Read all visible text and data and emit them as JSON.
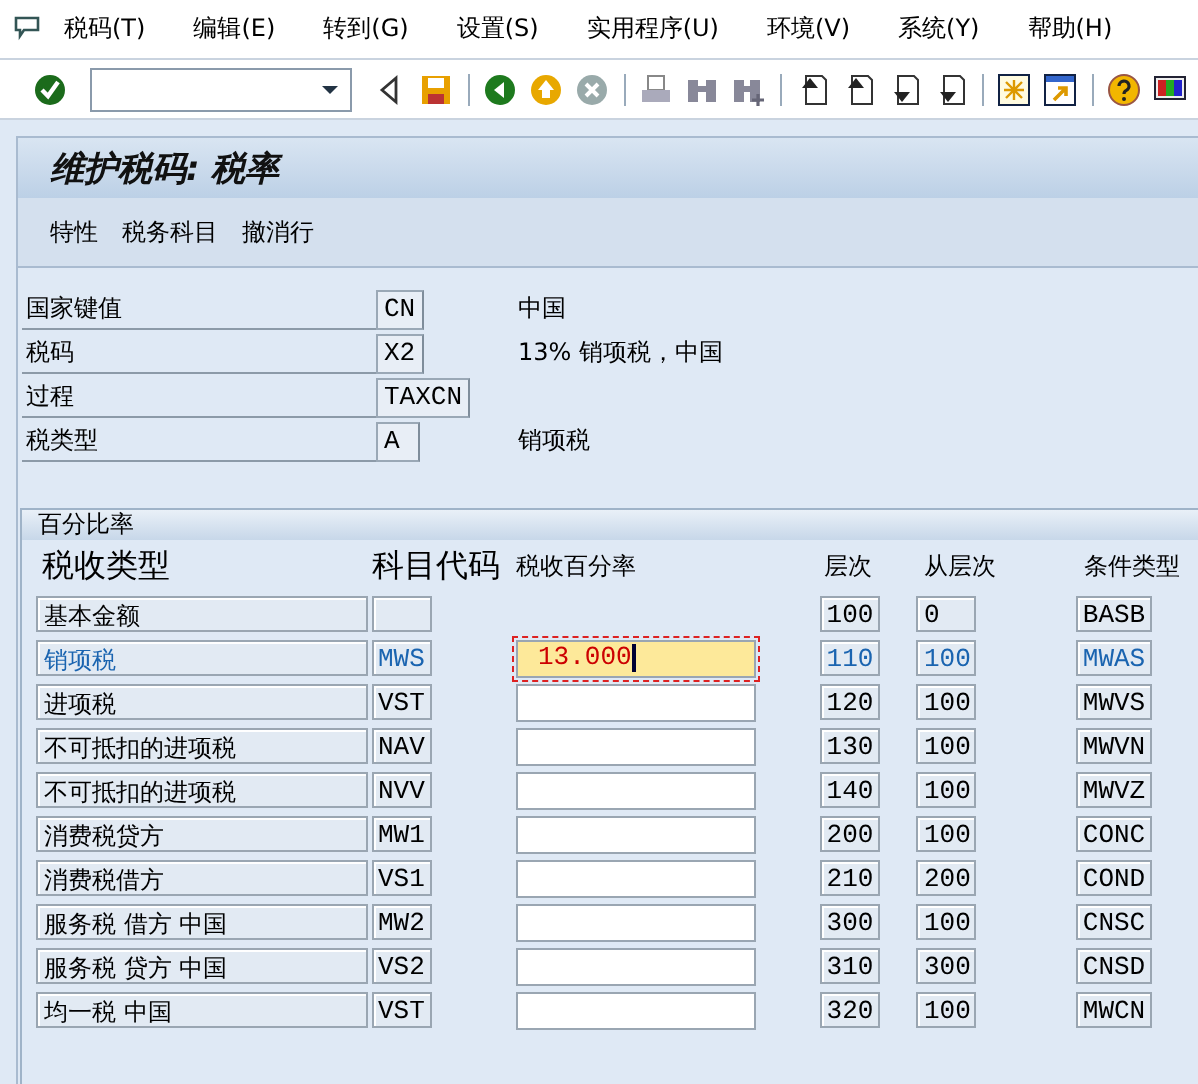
{
  "menu_bar": [
    "税码(T)",
    "编辑(E)",
    "转到(G)",
    "设置(S)",
    "实用程序(U)",
    "环境(V)",
    "系统(Y)",
    "帮助(H)"
  ],
  "title": "维护税码: 税率",
  "app_toolbar": [
    "特性",
    "税务科目",
    "撤消行"
  ],
  "header_fields": [
    {
      "label": "国家键值",
      "value": "CN",
      "description": "中国"
    },
    {
      "label": "税码",
      "value": "X2",
      "description": "13% 销项税，中国"
    },
    {
      "label": "过程",
      "value": "TAXCN"
    },
    {
      "label": "税类型",
      "value": "A",
      "description": "销项税"
    }
  ],
  "rates": {
    "title": "百分比率",
    "columns": [
      "税收类型",
      "科目代码",
      "税收百分率",
      "层次",
      "从层次",
      "条件类型"
    ],
    "rows": [
      {
        "kind": "base",
        "tax_type": "基本金额",
        "level_no": "100",
        "from_level": "0",
        "condition_type": "BASB",
        "selected": false
      },
      {
        "kind": "tax",
        "tax_type": "销项税",
        "account_key": "MWS",
        "rate": "13.000",
        "level_no": "110",
        "from_level": "100",
        "condition_type": "MWAS",
        "selected": true
      },
      {
        "kind": "tax",
        "tax_type": "进项税",
        "account_key": "VST",
        "level_no": "120",
        "from_level": "100",
        "condition_type": "MWVS",
        "selected": false
      },
      {
        "kind": "tax",
        "tax_type": "不可抵扣的进项税",
        "account_key": "NAV",
        "level_no": "130",
        "from_level": "100",
        "condition_type": "MWVN",
        "selected": false
      },
      {
        "kind": "tax",
        "tax_type": "不可抵扣的进项税",
        "account_key": "NVV",
        "level_no": "140",
        "from_level": "100",
        "condition_type": "MWVZ",
        "selected": false
      },
      {
        "kind": "tax",
        "tax_type": "消费税贷方",
        "account_key": "MW1",
        "level_no": "200",
        "from_level": "100",
        "condition_type": "CONC",
        "selected": false
      },
      {
        "kind": "tax",
        "tax_type": "消费税借方",
        "account_key": "VS1",
        "level_no": "210",
        "from_level": "200",
        "condition_type": "COND",
        "selected": false
      },
      {
        "kind": "tax",
        "tax_type": "服务税 借方 中国",
        "account_key": "MW2",
        "level_no": "300",
        "from_level": "100",
        "condition_type": "CNSC",
        "selected": false
      },
      {
        "kind": "tax",
        "tax_type": "服务税 贷方 中国",
        "account_key": "VS2",
        "level_no": "310",
        "from_level": "300",
        "condition_type": "CNSD",
        "selected": false
      },
      {
        "kind": "tax",
        "tax_type": "均一税 中国",
        "account_key": "VST",
        "level_no": "320",
        "from_level": "100",
        "condition_type": "MWCN",
        "selected": false
      }
    ]
  }
}
